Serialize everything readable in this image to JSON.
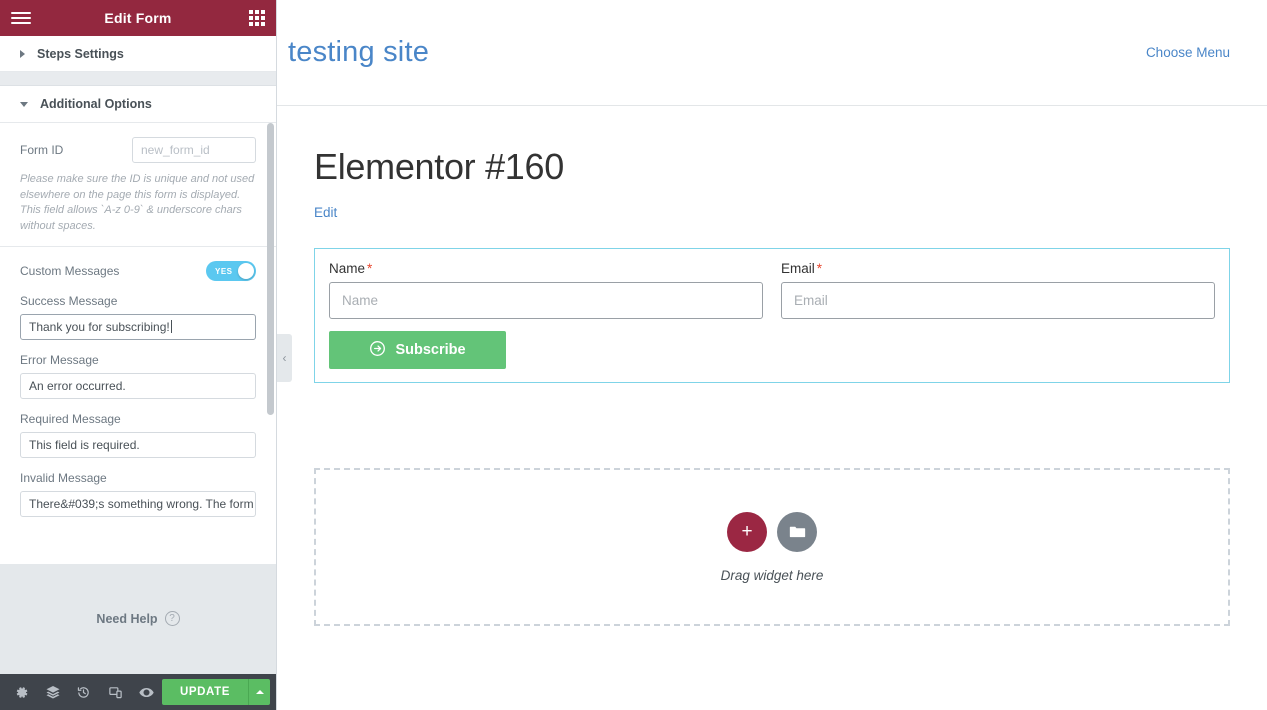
{
  "panel": {
    "header": {
      "title": "Edit Form",
      "menu_icon": "hamburger-icon",
      "apps_icon": "grid-apps-icon"
    },
    "sections": [
      {
        "key": "steps",
        "label": "Steps Settings",
        "expanded": false
      },
      {
        "key": "additional",
        "label": "Additional Options",
        "expanded": true
      }
    ],
    "form_id": {
      "label": "Form ID",
      "value": "",
      "placeholder": "new_form_id",
      "help": "Please make sure the ID is unique and not used elsewhere on the page this form is displayed. This field allows `A-z 0-9` & underscore chars without spaces."
    },
    "custom_messages": {
      "label": "Custom Messages",
      "toggle_value": "YES",
      "toggle_on": true
    },
    "messages": [
      {
        "key": "success",
        "label": "Success Message",
        "value": "Thank you for subscribing!",
        "focused": true
      },
      {
        "key": "error",
        "label": "Error Message",
        "value": "An error occurred.",
        "focused": false
      },
      {
        "key": "required",
        "label": "Required Message",
        "value": "This field is required.",
        "focused": false
      },
      {
        "key": "invalid",
        "label": "Invalid Message",
        "value": "There&#039;s something wrong. The form",
        "focused": false
      }
    ],
    "need_help": {
      "label": "Need Help",
      "icon": "question-circle-icon"
    },
    "footer": {
      "icons": [
        "gear-icon",
        "layers-icon",
        "history-icon",
        "responsive-mode-icon",
        "preview-eye-icon"
      ],
      "update_label": "UPDATE",
      "update_caret_icon": "caret-up-icon"
    },
    "collapse_icon": "chevron-left-icon"
  },
  "preview": {
    "site_title": "testing site",
    "choose_menu": "Choose Menu",
    "page_title": "Elementor #160",
    "edit_link": "Edit",
    "form": {
      "fields": [
        {
          "key": "name",
          "label": "Name",
          "required_mark": "*",
          "value": "",
          "placeholder": "Name"
        },
        {
          "key": "email",
          "label": "Email",
          "required_mark": "*",
          "value": "",
          "placeholder": "Email"
        }
      ],
      "submit_label": "Subscribe",
      "submit_icon": "arrow-circle-right-icon"
    },
    "dropzone": {
      "add_icon": "plus-icon",
      "folder_icon": "folder-icon",
      "text": "Drag widget here"
    }
  },
  "colors": {
    "panel_header": "#93283f",
    "accent_green": "#5bbd63",
    "toggle_blue": "#5bc8f0",
    "link_blue": "#4a86c8",
    "selection_border": "#7fd4e8",
    "required_red": "#e8462e",
    "dz_add": "#9b2743"
  }
}
